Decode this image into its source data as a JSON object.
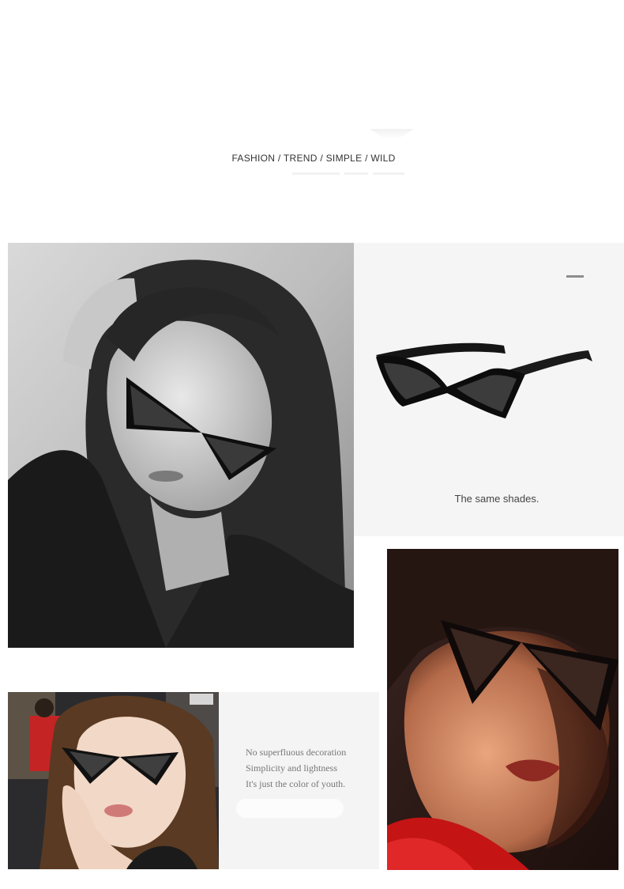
{
  "header": {
    "tagline": "FASHION / TREND / SIMPLE / WILD"
  },
  "product_panel": {
    "caption": "The same shades."
  },
  "text_panel": {
    "lines": [
      "No superfluous decoration",
      "Simplicity and lightness",
      "It's just the color of youth."
    ]
  },
  "colors": {
    "background": "#ffffff",
    "panel_gray": "#f5f5f5",
    "frame_black": "#111111",
    "scarf_red": "#c41414"
  }
}
